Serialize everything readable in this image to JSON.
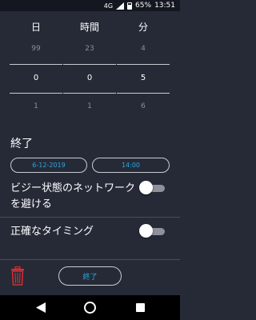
{
  "status_bar": {
    "signal_text": "4G",
    "battery_percent": "65%",
    "time": "13:51"
  },
  "picker": {
    "columns": [
      {
        "header": "日",
        "prev": "99",
        "current": "0",
        "next": "1"
      },
      {
        "header": "時間",
        "prev": "23",
        "current": "0",
        "next": "1"
      },
      {
        "header": "分",
        "prev": "4",
        "current": "5",
        "next": "6"
      }
    ]
  },
  "end_section": {
    "label": "終了",
    "date": "6-12-2019",
    "time": "14:00"
  },
  "settings": {
    "avoid_busy_network": {
      "label": "ビジー状態のネットワークを避ける",
      "enabled": false
    },
    "precise_timing": {
      "label": "正確なタイミング",
      "enabled": false
    }
  },
  "actions": {
    "finish_label": "終了",
    "delete_icon": "trash-icon"
  },
  "colors": {
    "background": "#262a37",
    "accent": "#29a8e0",
    "delete": "#d32f2f"
  }
}
